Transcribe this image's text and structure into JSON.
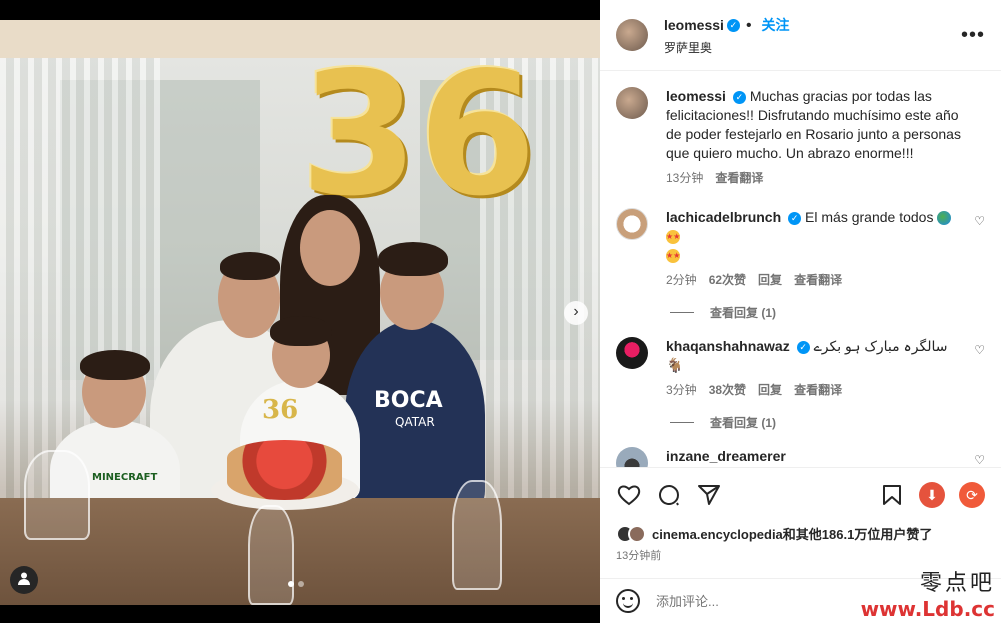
{
  "media": {
    "balloon_text": "36",
    "candle_text": "36",
    "shirt_texts": [
      "MINECRAFT",
      "BOCA",
      "QATAR"
    ]
  },
  "post": {
    "author": "leomessi",
    "follow_label": "关注",
    "location": "罗萨里奥",
    "more_icon": "more-icon",
    "caption_author": "leomessi",
    "caption": "Muchas gracias por todas las felicitaciones!! Disfrutando muchísimo este año de poder festejarlo en Rosario junto a personas que quiero mucho. Un abrazo enorme!!!",
    "caption_time": "13分钟",
    "caption_translate": "查看翻译"
  },
  "comments": [
    {
      "user": "lachicadelbrunch",
      "text": "El más grande todos",
      "time": "2分钟",
      "likes": "62次赞",
      "reply": "回复",
      "translate": "查看翻译",
      "view_replies": "查看回复 (1)"
    },
    {
      "user": "khaqanshahnawaz",
      "text": "سالگرہ مبارک ہو بکرے 🐐",
      "time": "3分钟",
      "likes": "38次赞",
      "reply": "回复",
      "translate": "查看翻译",
      "view_replies": "查看回复 (1)"
    },
    {
      "user": "inzane_dreamerer",
      "text": ""
    }
  ],
  "actions": {
    "likes_text": "cinema.encyclopedia和其他186.1万位用户赞了",
    "time_ago": "13分钟前",
    "comment_placeholder": "添加评论..."
  },
  "watermark": {
    "line1": "零点吧",
    "line2": "www.Ldb.cc"
  },
  "colors": {
    "verified": "#0095f6",
    "follow": "#0095f6",
    "download": "#e5533d"
  }
}
